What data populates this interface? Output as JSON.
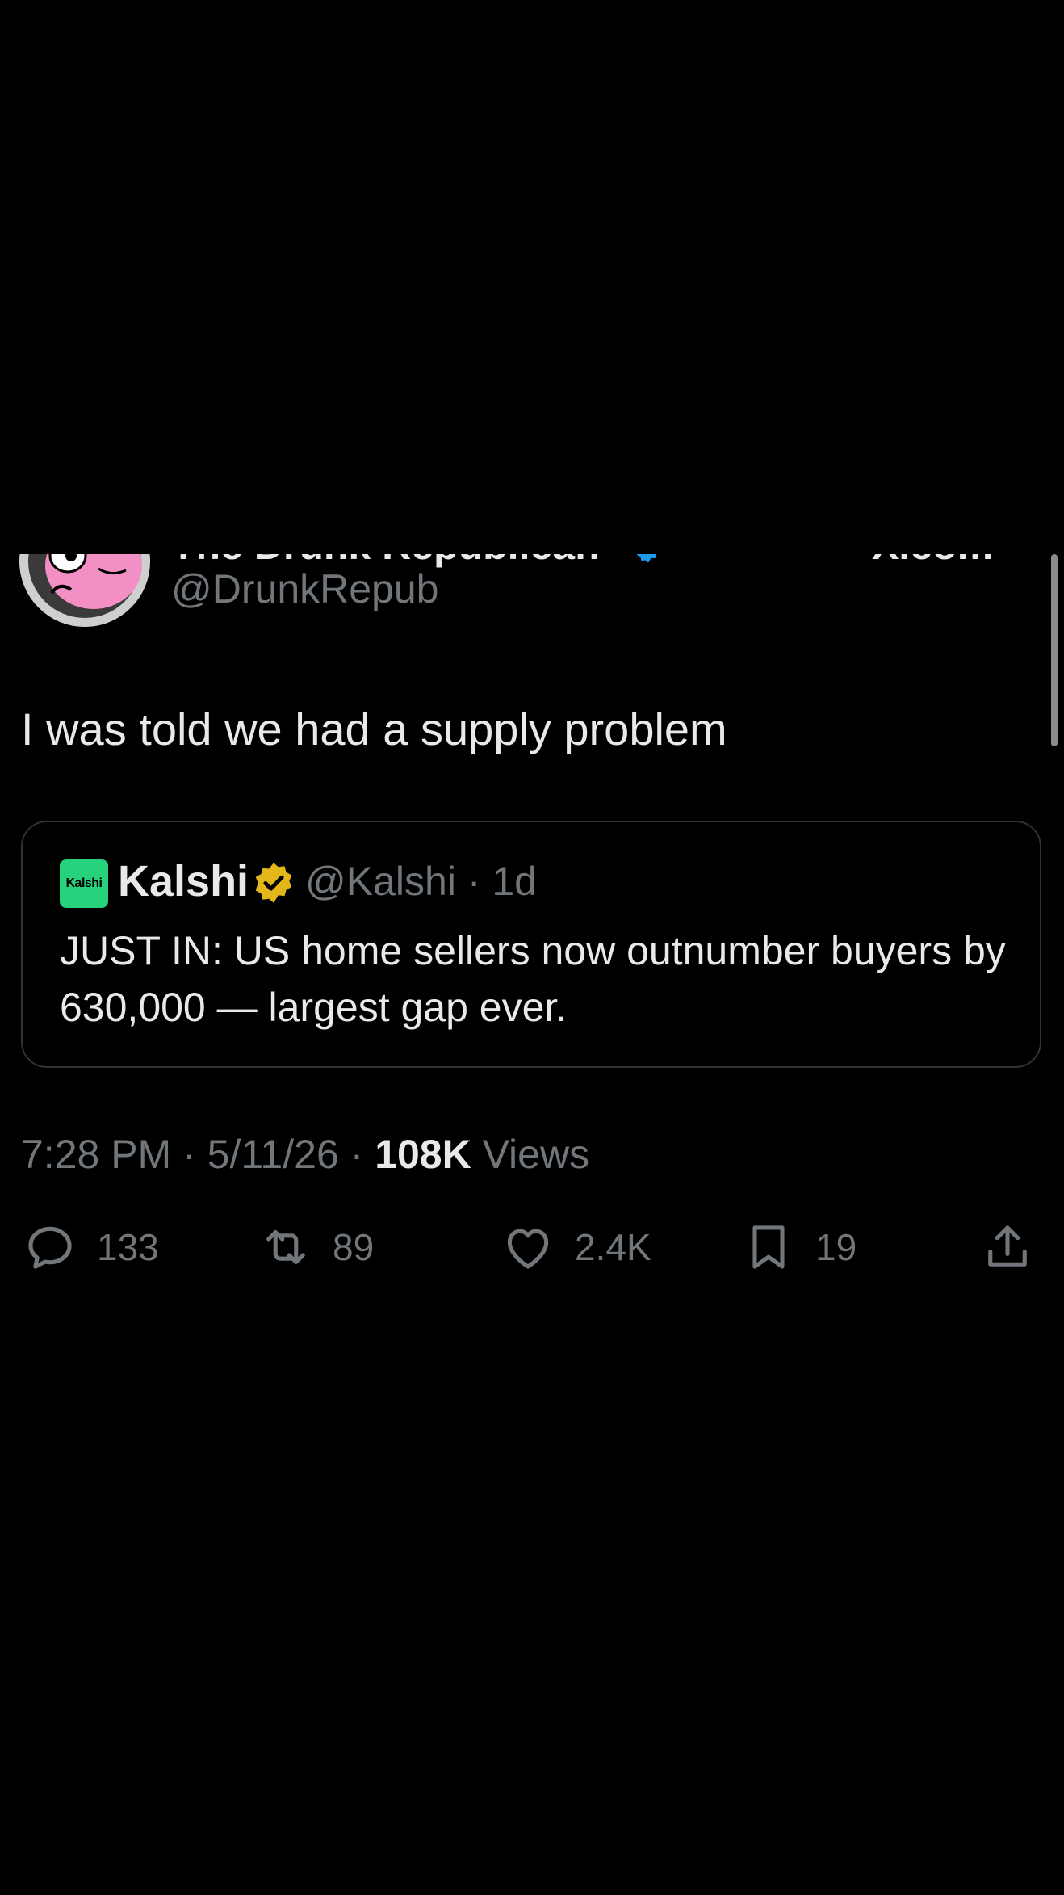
{
  "post": {
    "author_name": "The Drunk Republican",
    "author_handle": "@DrunkRepub",
    "more_label": "X.com",
    "text": "I was told we had a supply problem",
    "timestamp": "7:28 PM · 5/11/26 · ",
    "views_count": "108K",
    "views_label": " Views"
  },
  "quote": {
    "logo_text": "Kalshi",
    "name": "Kalshi",
    "handle_time": "@Kalshi · 1d",
    "body": "JUST IN: US home sellers now outnumber buyers by 630,000 — largest gap ever."
  },
  "actions": {
    "replies": "133",
    "reposts": "89",
    "likes": "2.4K",
    "bookmarks": "19"
  },
  "colors": {
    "background": "#000000",
    "text": "#e7e9ea",
    "secondary": "#71767b",
    "border": "#2f3336",
    "kalshi_green": "#28d17c",
    "gold_badge": "#e2b719",
    "blue_badge": "#1d9bf0"
  },
  "icons": [
    "reply-icon",
    "repost-icon",
    "like-icon",
    "bookmark-icon",
    "share-icon",
    "verified-badge-icon",
    "gold-verified-badge-icon"
  ]
}
